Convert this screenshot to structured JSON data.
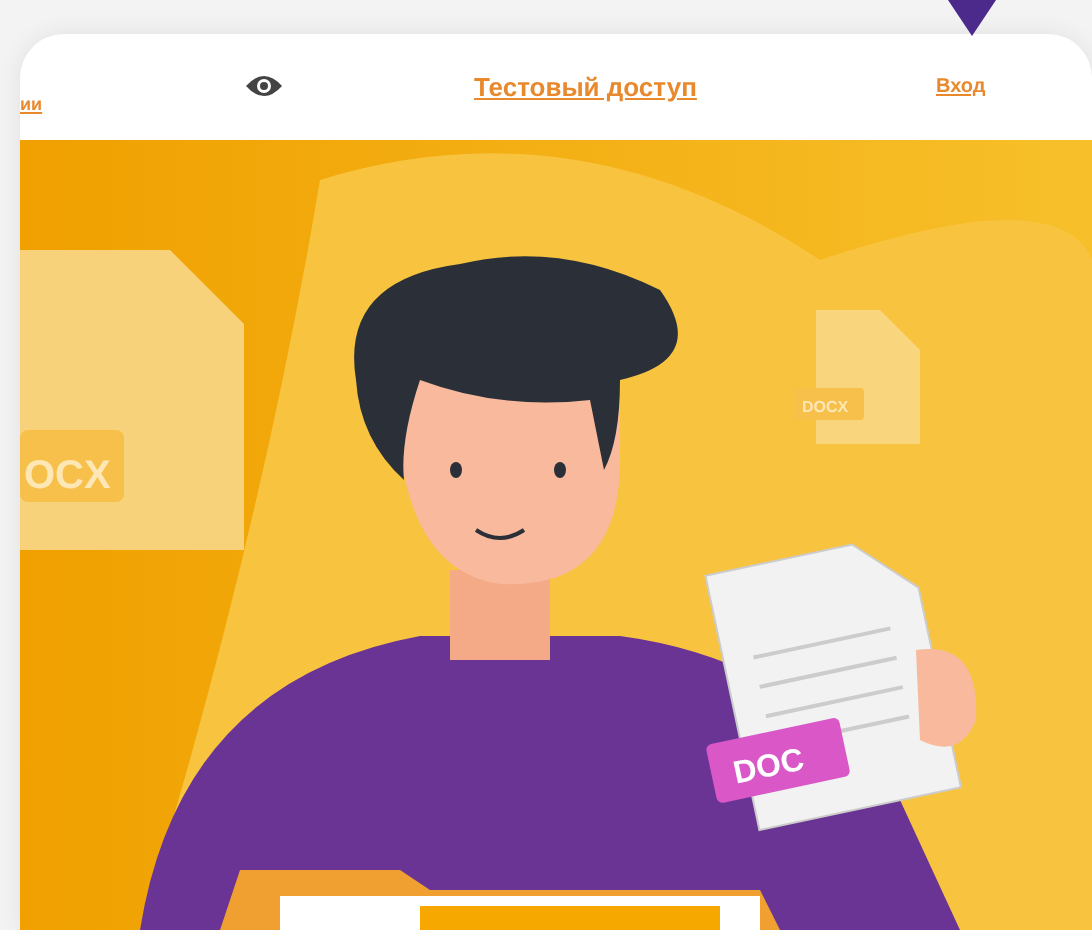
{
  "header": {
    "cut_link": "ии",
    "links": [
      {
        "label": "Тестовый доступ"
      },
      {
        "label": "Вход"
      }
    ]
  },
  "hero": {
    "file_labels": [
      "OCX",
      "DOCX",
      "DOC"
    ]
  }
}
